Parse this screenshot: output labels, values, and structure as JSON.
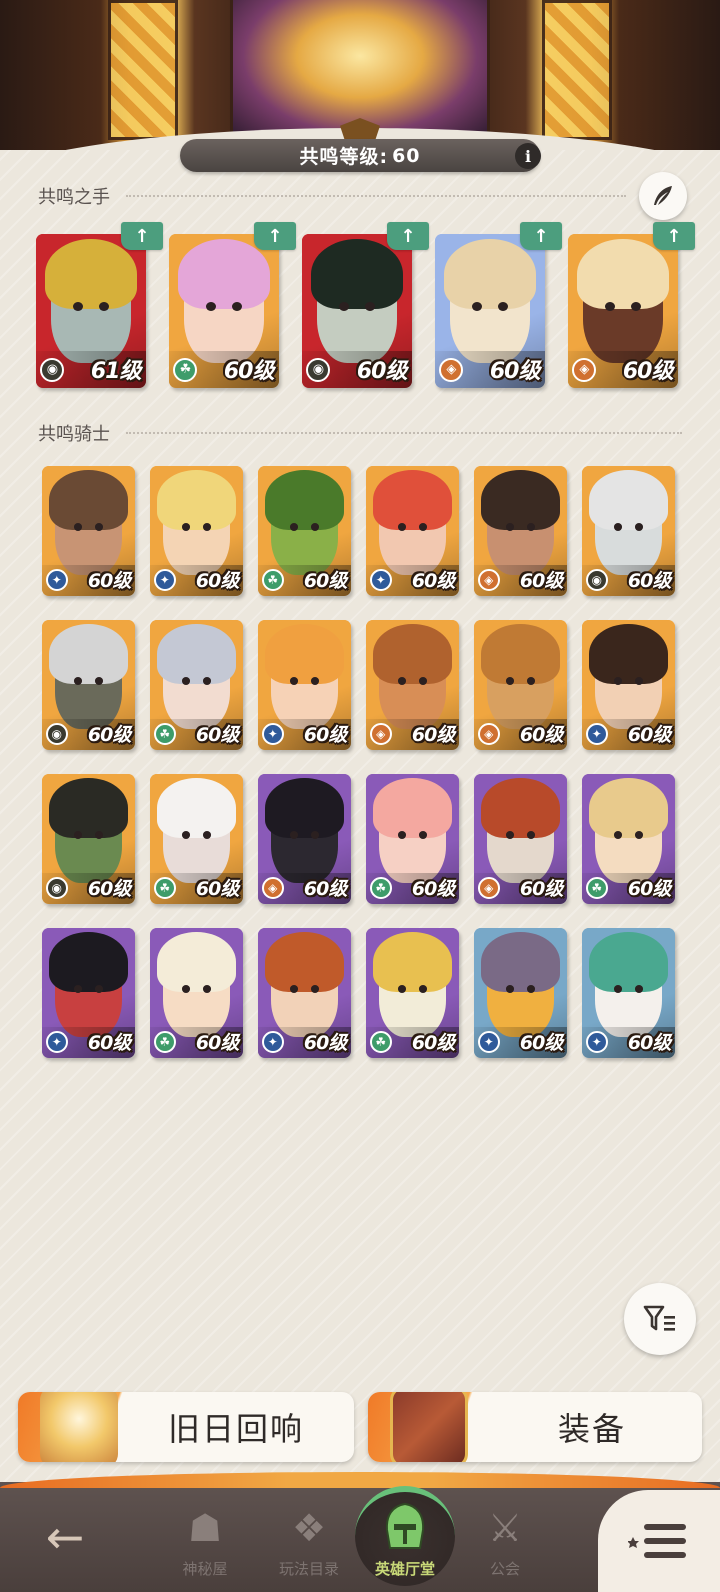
{
  "header": {
    "resonance_label": "共鸣等级:",
    "resonance_level": "60",
    "info_icon": "i"
  },
  "sections": {
    "hands_title": "共鸣之手",
    "knights_title": "共鸣骑士"
  },
  "hands": [
    {
      "level": "61级",
      "bg": "#c8262c",
      "hair": "#d6b03a",
      "skin": "#a8b8b4",
      "faction": "graveborn",
      "up": true
    },
    {
      "level": "60级",
      "bg": "#f0a640",
      "hair": "#e4a6d8",
      "skin": "#f6d6c4",
      "faction": "wilder",
      "up": true
    },
    {
      "level": "60级",
      "bg": "#c8262c",
      "hair": "#1e2a22",
      "skin": "#c4ccc0",
      "faction": "graveborn",
      "up": true
    },
    {
      "level": "60级",
      "bg": "#9ab4e8",
      "hair": "#e8d2a8",
      "skin": "#f2e4cc",
      "faction": "mauler",
      "up": true
    },
    {
      "level": "60级",
      "bg": "#f0a640",
      "hair": "#f2dcae",
      "skin": "#6a3a28",
      "faction": "mauler",
      "up": true
    }
  ],
  "knights": [
    {
      "level": "60级",
      "bg": "#f0a640",
      "hair": "#6a4a34",
      "skin": "#c89474",
      "faction": "lightbearer"
    },
    {
      "level": "60级",
      "bg": "#f0a640",
      "hair": "#f0d67a",
      "skin": "#f4d4b4",
      "faction": "lightbearer"
    },
    {
      "level": "60级",
      "bg": "#f0a640",
      "hair": "#4a7a2a",
      "skin": "#8ab048",
      "faction": "wilder"
    },
    {
      "level": "60级",
      "bg": "#f0a640",
      "hair": "#e0503a",
      "skin": "#f2c8b0",
      "faction": "lightbearer"
    },
    {
      "level": "60级",
      "bg": "#f0a640",
      "hair": "#3a2a22",
      "skin": "#c89070",
      "faction": "mauler"
    },
    {
      "level": "60级",
      "bg": "#f0a640",
      "hair": "#e4e4e4",
      "skin": "#d8dcdc",
      "faction": "graveborn"
    },
    {
      "level": "60级",
      "bg": "#f0a640",
      "hair": "#d4d4d4",
      "skin": "#6a6a5a",
      "faction": "graveborn"
    },
    {
      "level": "60级",
      "bg": "#f0a640",
      "hair": "#c4c8d4",
      "skin": "#f2dcd0",
      "faction": "wilder"
    },
    {
      "level": "60级",
      "bg": "#f0a640",
      "hair": "#f0a040",
      "skin": "#f6d2b6",
      "faction": "lightbearer"
    },
    {
      "level": "60级",
      "bg": "#f0a640",
      "hair": "#b0622e",
      "skin": "#d88e56",
      "faction": "mauler"
    },
    {
      "level": "60级",
      "bg": "#f0a640",
      "hair": "#c07a34",
      "skin": "#d8a060",
      "faction": "mauler"
    },
    {
      "level": "60级",
      "bg": "#f0a640",
      "hair": "#3a261c",
      "skin": "#f2d0b4",
      "faction": "lightbearer"
    },
    {
      "level": "60级",
      "bg": "#f0a640",
      "hair": "#2a2a24",
      "skin": "#6a8a50",
      "faction": "graveborn"
    },
    {
      "level": "60级",
      "bg": "#f0a640",
      "hair": "#f4f2f0",
      "skin": "#e8dcd8",
      "faction": "wilder"
    },
    {
      "level": "60级",
      "bg": "#8a5ab8",
      "hair": "#1e1a22",
      "skin": "#2c2830",
      "faction": "mauler"
    },
    {
      "level": "60级",
      "bg": "#8a5ab8",
      "hair": "#f4a8a0",
      "skin": "#f6d0c4",
      "faction": "wilder"
    },
    {
      "level": "60级",
      "bg": "#8a5ab8",
      "hair": "#b84a2a",
      "skin": "#e4d8cc",
      "faction": "mauler"
    },
    {
      "level": "60级",
      "bg": "#8a5ab8",
      "hair": "#e8ca8c",
      "skin": "#f4dcc0",
      "faction": "wilder"
    },
    {
      "level": "60级",
      "bg": "#8a5ab8",
      "hair": "#1c1a20",
      "skin": "#c84040",
      "faction": "lightbearer"
    },
    {
      "level": "60级",
      "bg": "#8a5ab8",
      "hair": "#f4ecd8",
      "skin": "#f6dcc4",
      "faction": "wilder"
    },
    {
      "level": "60级",
      "bg": "#8a5ab8",
      "hair": "#c05a2a",
      "skin": "#f2d2b8",
      "faction": "lightbearer"
    },
    {
      "level": "60级",
      "bg": "#8a5ab8",
      "hair": "#e8c050",
      "skin": "#f2ecd8",
      "faction": "wilder"
    },
    {
      "level": "60级",
      "bg": "#78a8c8",
      "hair": "#7a6a86",
      "skin": "#f0b040",
      "faction": "lightbearer"
    },
    {
      "level": "60级",
      "bg": "#78a8c8",
      "hair": "#4aa890",
      "skin": "#f4f0ec",
      "faction": "lightbearer"
    }
  ],
  "buttons": {
    "echoes_label": "旧日回响",
    "equipment_label": "装备"
  },
  "nav": {
    "items": [
      {
        "label": "神秘屋",
        "icon": "mystic-house-icon"
      },
      {
        "label": "玩法目录",
        "icon": "game-modes-icon"
      },
      {
        "label": "英雄厅堂",
        "icon": "hero-hall-icon"
      },
      {
        "label": "公会",
        "icon": "guild-icon"
      }
    ]
  },
  "colors": {
    "accent_green": "#4c9e7e",
    "faction_lightbearer": "#2f5a9a",
    "faction_wilder": "#3e9c6a",
    "faction_mauler": "#d07030",
    "faction_graveborn": "#3a3a30"
  }
}
